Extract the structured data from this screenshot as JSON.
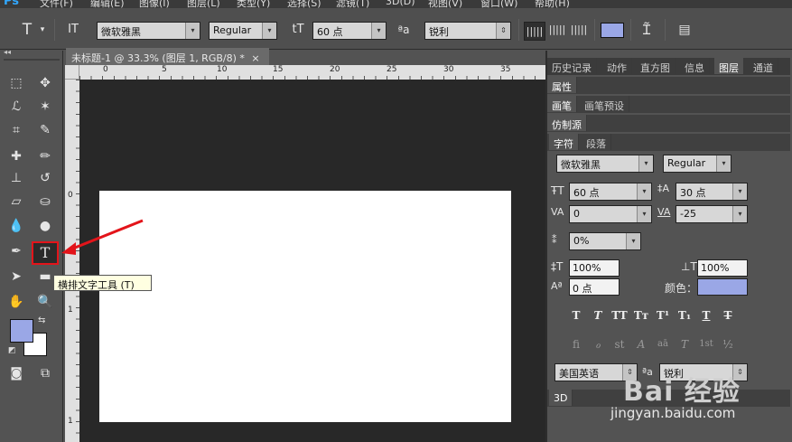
{
  "menubar": {
    "logo": "Ps",
    "items": [
      "文件(F)",
      "编辑(E)",
      "图像(I)",
      "图层(L)",
      "类型(Y)",
      "选择(S)",
      "滤镜(T)",
      "3D(D)",
      "视图(V)",
      "窗口(W)",
      "帮助(H)"
    ]
  },
  "options": {
    "tool_icon": "T",
    "orient_icon": "IT",
    "font_family": "微软雅黑",
    "font_style": "Regular",
    "size_icon": "tT",
    "font_size": "60 点",
    "aa_icon": "ªa",
    "antialias": "锐利",
    "color": "#9aa7e6"
  },
  "document": {
    "tab_title": "未标题-1 @ 33.3% (图层 1, RGB/8) *",
    "close": "×",
    "ruler_h": [
      "0",
      "5",
      "10",
      "15",
      "20",
      "25",
      "30",
      "35"
    ],
    "ruler_v": [
      "0",
      "5",
      "1",
      "1"
    ]
  },
  "toolbar": {
    "collapse": "◂◂",
    "foreground": "#9aa7e6",
    "background": "#ffffff"
  },
  "tooltip": "横排文字工具 (T)",
  "panels": {
    "top_tabs": [
      "历史记录",
      "动作",
      "直方图",
      "信息",
      "图层",
      "通道"
    ],
    "properties": "属性",
    "brush_tabs": [
      "画笔",
      "画笔预设"
    ],
    "clone_source": "仿制源",
    "char_tabs": [
      "字符",
      "段落"
    ],
    "font_family": "微软雅黑",
    "font_style": "Regular",
    "size": "60 点",
    "leading": "30 点",
    "kerning": "0",
    "tracking": "-25",
    "tsume": "0%",
    "vscale": "100%",
    "hscale": "100%",
    "baseline": "0 点",
    "color_label": "颜色：",
    "color": "#9aa7e6",
    "style_buttons": [
      "T",
      "T",
      "TT",
      "Tт",
      "T¹",
      "T₁",
      "T",
      "T"
    ],
    "ot_buttons": [
      "fi",
      "ℴ",
      "st",
      "A",
      "aā",
      "T",
      "1st",
      "½"
    ],
    "language": "美国英语",
    "aa_label": "ªa",
    "antialias": "锐利",
    "three_d": "3D"
  },
  "watermark": {
    "brand": "Bai 经验",
    "url": "jingyan.baidu.com"
  }
}
